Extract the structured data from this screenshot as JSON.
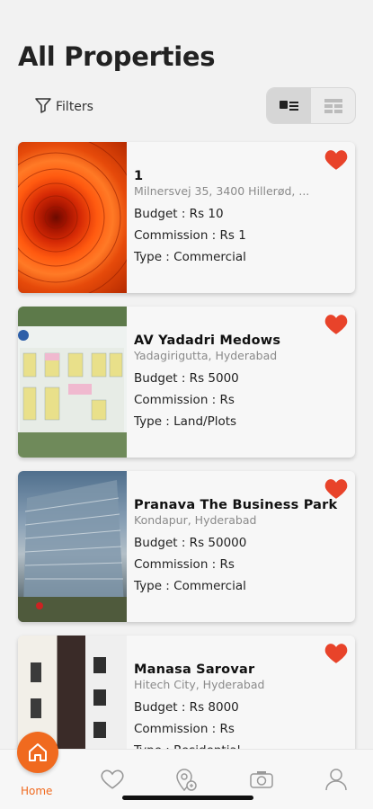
{
  "page": {
    "title": "All Properties"
  },
  "toolbar": {
    "filters_label": "Filters"
  },
  "colors": {
    "accent": "#f06a1f",
    "heart": "#e8432a"
  },
  "properties": [
    {
      "name": "1",
      "location": "Milnersvej 35, 3400 Hillerød, ...",
      "budget": "Budget : Rs 10",
      "commission": "Commission : Rs 1",
      "type": "Type : Commercial",
      "image": "orange-flower"
    },
    {
      "name": "AV Yadadri Medows",
      "location": "Yadagirigutta, Hyderabad",
      "budget": "Budget : Rs 5000",
      "commission": "Commission : Rs",
      "type": "Type : Land/Plots",
      "image": "plot-layout-plan"
    },
    {
      "name": "Pranava The Business Park",
      "location": "Kondapur, Hyderabad",
      "budget": "Budget : Rs 50000",
      "commission": "Commission : Rs",
      "type": "Type : Commercial",
      "image": "glass-office-building"
    },
    {
      "name": "Manasa Sarovar",
      "location": "Hitech City, Hyderabad",
      "budget": "Budget : Rs 8000",
      "commission": "Commission : Rs",
      "type": "Type : Residential",
      "image": "apartment-building"
    }
  ],
  "tabbar": {
    "home_label": "Home",
    "icons": [
      "home-icon",
      "heart-icon",
      "location-pin-icon",
      "camera-icon",
      "user-icon"
    ]
  }
}
